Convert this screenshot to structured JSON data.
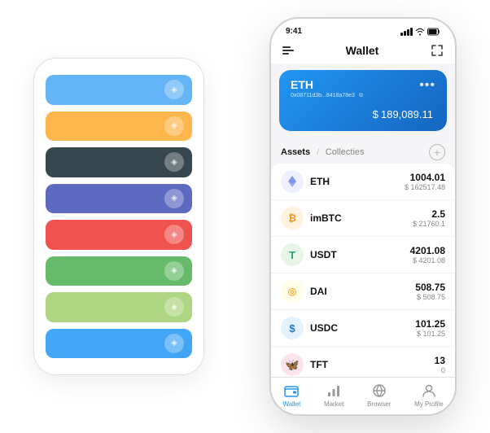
{
  "scene": {
    "bg_device": {
      "cards": [
        {
          "color": "#64B5F6",
          "icon": "◈"
        },
        {
          "color": "#FFB74D",
          "icon": "◈"
        },
        {
          "color": "#37474F",
          "icon": "◈"
        },
        {
          "color": "#5C6BC0",
          "icon": "◈"
        },
        {
          "color": "#EF5350",
          "icon": "◈"
        },
        {
          "color": "#66BB6A",
          "icon": "◈"
        },
        {
          "color": "#AED581",
          "icon": "◈"
        },
        {
          "color": "#42A5F5",
          "icon": "◈"
        }
      ]
    },
    "phone": {
      "status_bar": {
        "time": "9:41",
        "signal": "▌▌▌",
        "wifi": "wifi",
        "battery": "🔋"
      },
      "header": {
        "menu_icon": "≡",
        "title": "Wallet",
        "expand_icon": "⤢"
      },
      "eth_card": {
        "name": "ETH",
        "address": "0x08711d3b...8418a78e3",
        "copy_icon": "⧉",
        "dots": "•••",
        "currency_symbol": "$",
        "amount": "189,089.11"
      },
      "assets_section": {
        "tab_active": "Assets",
        "tab_divider": "/",
        "tab_inactive": "Collecties",
        "add_icon": "+"
      },
      "assets": [
        {
          "symbol": "ETH",
          "name": "ETH",
          "icon": "♦",
          "icon_class": "icon-eth",
          "icon_bg": "#EEF0FF",
          "amount": "1004.01",
          "usd": "$ 162517.48"
        },
        {
          "symbol": "imBTC",
          "name": "imBTC",
          "icon": "₿",
          "icon_class": "icon-imbtc",
          "icon_bg": "#FFF3E0",
          "amount": "2.5",
          "usd": "$ 21760.1"
        },
        {
          "symbol": "USDT",
          "name": "USDT",
          "icon": "T",
          "icon_class": "icon-usdt",
          "icon_bg": "#E8F5E9",
          "amount": "4201.08",
          "usd": "$ 4201.08"
        },
        {
          "symbol": "DAI",
          "name": "DAI",
          "icon": "◎",
          "icon_class": "icon-dai",
          "icon_bg": "#FFFDE7",
          "amount": "508.75",
          "usd": "$ 508.75"
        },
        {
          "symbol": "USDC",
          "name": "USDC",
          "icon": "$",
          "icon_class": "icon-usdc",
          "icon_bg": "#E3F2FD",
          "amount": "101.25",
          "usd": "$ 101.25"
        },
        {
          "symbol": "TFT",
          "name": "TFT",
          "icon": "🦋",
          "icon_class": "icon-tft",
          "icon_bg": "#FCE4EC",
          "amount": "13",
          "usd": "0"
        }
      ],
      "bottom_nav": [
        {
          "id": "wallet",
          "label": "Wallet",
          "active": true,
          "icon": "◉"
        },
        {
          "id": "market",
          "label": "Market",
          "active": false,
          "icon": "📊"
        },
        {
          "id": "browser",
          "label": "Browser",
          "active": false,
          "icon": "🌐"
        },
        {
          "id": "profile",
          "label": "My Profile",
          "active": false,
          "icon": "👤"
        }
      ]
    }
  }
}
